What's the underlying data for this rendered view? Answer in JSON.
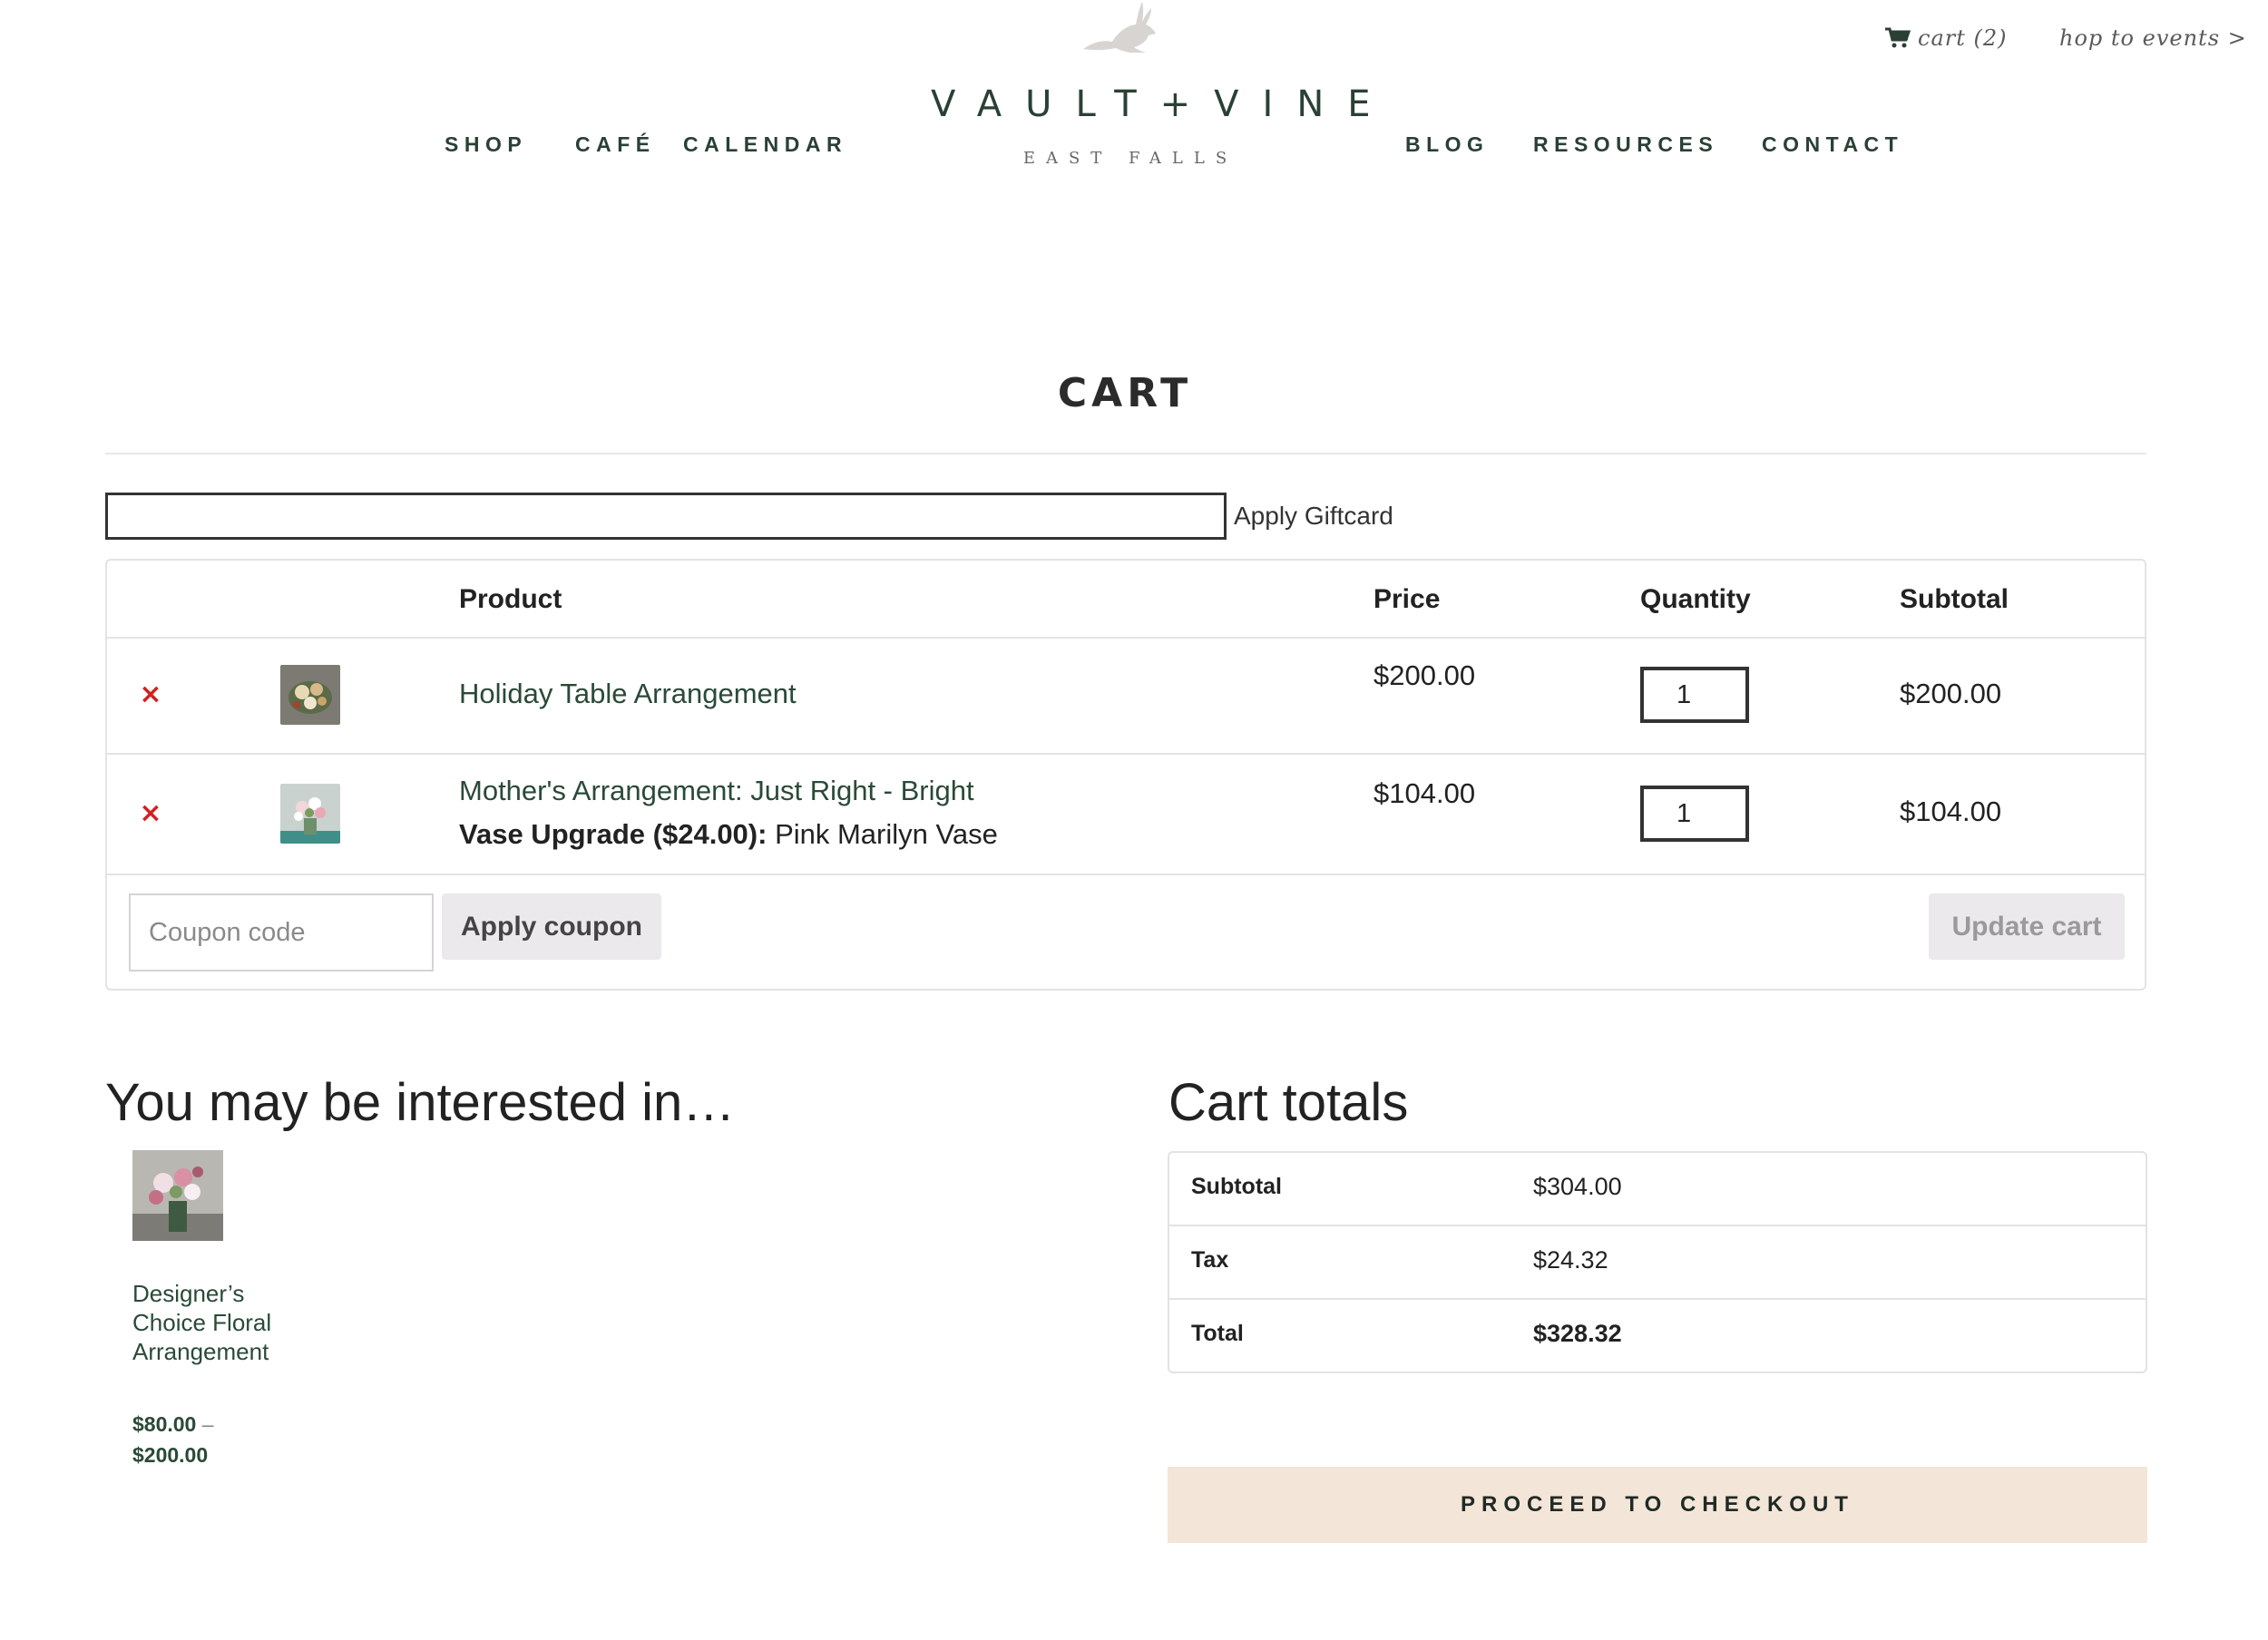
{
  "header": {
    "cart_link": "cart (2)",
    "hop_link": "hop to events >",
    "nav_left": [
      "SHOP",
      "CAFÉ",
      "CALENDAR"
    ],
    "nav_right": [
      "BLOG",
      "RESOURCES",
      "CONTACT"
    ],
    "logo_main": "VAULT+VINE",
    "logo_sub": "EAST FALLS",
    "rabbit_icon": "rabbit-icon"
  },
  "page": {
    "title": "CART"
  },
  "giftcard": {
    "value": "",
    "label": "Apply Giftcard"
  },
  "table": {
    "headers": {
      "product": "Product",
      "price": "Price",
      "quantity": "Quantity",
      "subtotal": "Subtotal"
    },
    "rows": [
      {
        "remove": "×",
        "name": "Holiday Table Arrangement",
        "meta_label": "",
        "meta_value": "",
        "price": "$200.00",
        "quantity": "1",
        "subtotal": "$200.00"
      },
      {
        "remove": "×",
        "name": "Mother's Arrangement: Just Right - Bright",
        "meta_label": "Vase Upgrade ($24.00):",
        "meta_value": " Pink Marilyn Vase",
        "price": "$104.00",
        "quantity": "1",
        "subtotal": "$104.00"
      }
    ],
    "coupon_placeholder": "Coupon code",
    "apply_coupon": "Apply coupon",
    "update_cart": "Update cart"
  },
  "cross_sells": {
    "heading": "You may be interested in…",
    "items": [
      {
        "name": "Designer’s Choice Floral Arrangement",
        "price_low": "$80.00",
        "price_sep": " – ",
        "price_high": "$200.00"
      }
    ]
  },
  "totals": {
    "heading": "Cart totals",
    "rows": [
      {
        "label": "Subtotal",
        "value": "$304.00"
      },
      {
        "label": "Tax",
        "value": "$24.32"
      },
      {
        "label": "Total",
        "value": "$328.32"
      }
    ],
    "checkout": "PROCEED TO CHECKOUT"
  },
  "colors": {
    "brand_green": "#2a4034",
    "remove_red": "#d32020",
    "checkout_bg": "#f3e5d8",
    "button_grey": "#ebe9eb"
  }
}
